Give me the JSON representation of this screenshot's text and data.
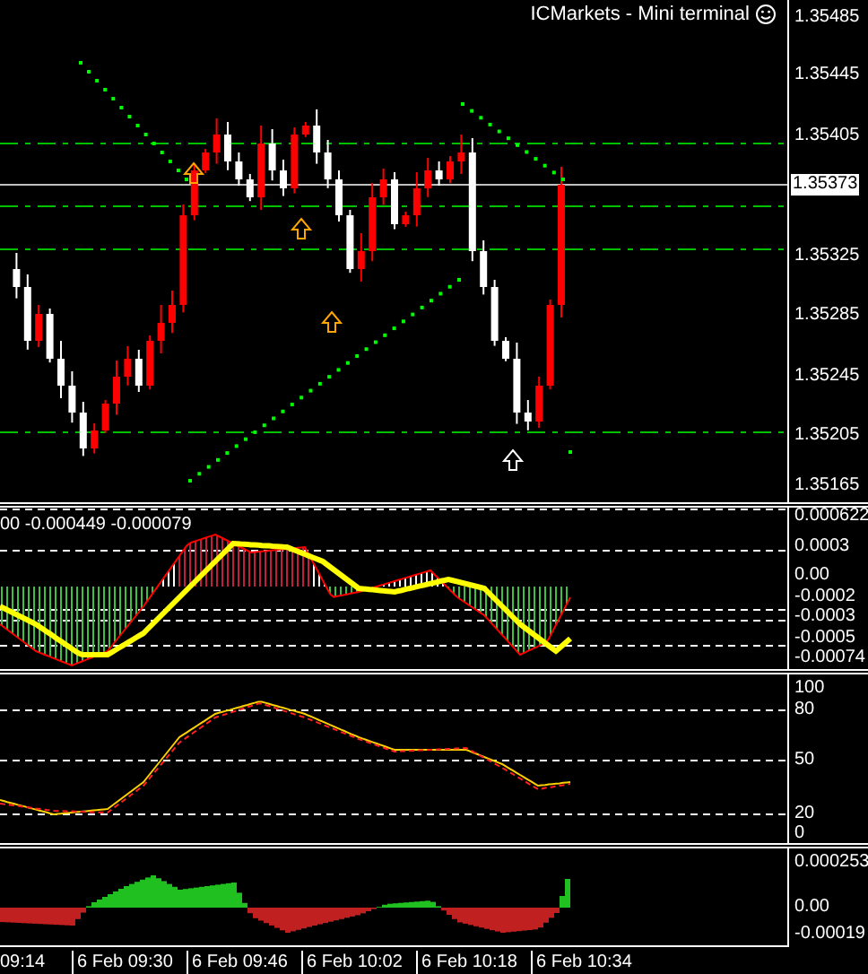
{
  "chart": {
    "title": "ICMarkets - Mini terminal",
    "price_axis": [
      "1.35485",
      "1.35445",
      "1.35405",
      "1.35325",
      "1.35285",
      "1.35245",
      "1.35205",
      "1.35165"
    ],
    "current_price": "1.35373"
  },
  "macd": {
    "values_label": "00 -0.000449 -0.000079",
    "axis": [
      "0.000622",
      "0.0003",
      "0.00",
      "-0.0002",
      "-0.0003",
      "-0.0005",
      "-0.00074"
    ]
  },
  "stochastic": {
    "axis": [
      "100",
      "80",
      "50",
      "20",
      "0"
    ]
  },
  "histogram": {
    "axis": [
      "0.000253",
      "0.00",
      "-0.00019"
    ]
  },
  "time_axis": [
    "09:14",
    "6 Feb 09:30",
    "6 Feb 09:46",
    "6 Feb 10:02",
    "6 Feb 10:18",
    "6 Feb 10:34"
  ]
}
